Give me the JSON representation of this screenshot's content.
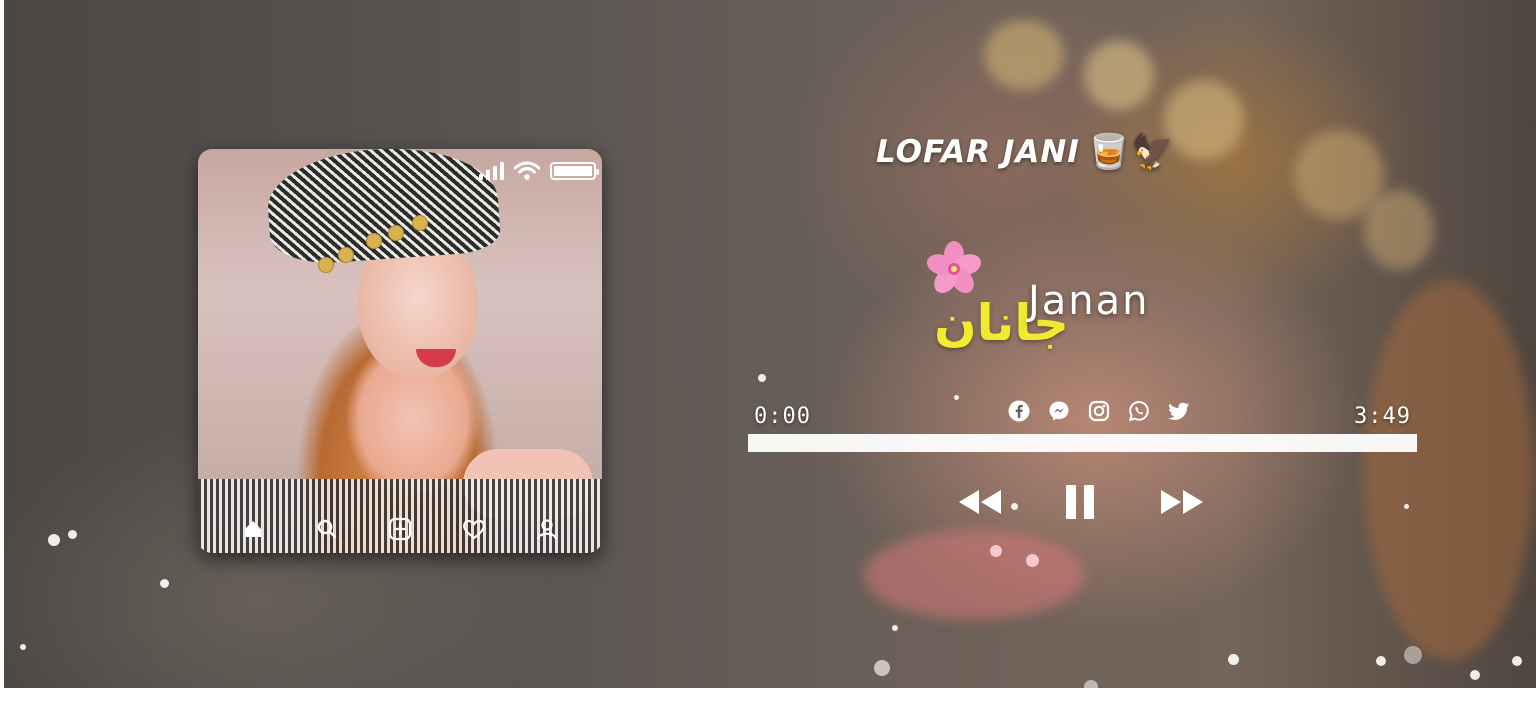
{
  "channel": {
    "name": "LOFAR JANI",
    "emoji": "🥃🦅"
  },
  "song": {
    "title_en": "Janan",
    "title_ur": "جانان",
    "flower_icon": "cherry-blossom-icon"
  },
  "player": {
    "current_time": "0:00",
    "total_time": "3:49",
    "progress": 0.0,
    "state": "playing",
    "controls": [
      "rewind-icon",
      "pause-icon",
      "fast-forward-icon"
    ]
  },
  "social_icons": [
    "facebook-icon",
    "messenger-icon",
    "instagram-icon",
    "whatsapp-icon",
    "twitter-icon"
  ],
  "phone_card": {
    "status_icons": [
      "signal-icon",
      "wifi-icon",
      "battery-icon"
    ],
    "battery_level": 1.0,
    "nav_icons": [
      "home-icon",
      "search-icon",
      "add-post-icon",
      "heart-icon",
      "profile-icon"
    ]
  },
  "colors": {
    "accent_yellow": "#f2ea2e",
    "text_white": "#ffffff",
    "progress_bar": "#ffffff"
  }
}
